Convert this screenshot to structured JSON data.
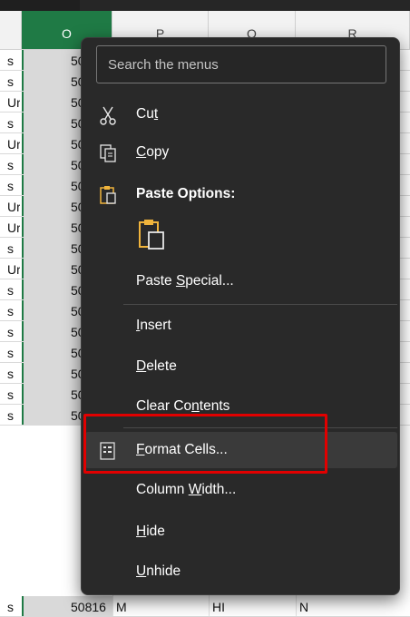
{
  "spreadsheet": {
    "columns": [
      "",
      "O",
      "P",
      "Q",
      "R"
    ],
    "rows": [
      {
        "a": "s",
        "o": "50"
      },
      {
        "a": "s",
        "o": "50"
      },
      {
        "a": "Ur",
        "o": "50"
      },
      {
        "a": "s",
        "o": "50"
      },
      {
        "a": "Ur",
        "o": "50"
      },
      {
        "a": "s",
        "o": "50"
      },
      {
        "a": "s",
        "o": "50"
      },
      {
        "a": "Ur",
        "o": "50"
      },
      {
        "a": "Ur",
        "o": "50"
      },
      {
        "a": "s",
        "o": "50"
      },
      {
        "a": "Ur",
        "o": "50"
      },
      {
        "a": "s",
        "o": "50"
      },
      {
        "a": "s",
        "o": "50"
      },
      {
        "a": "s",
        "o": "50"
      },
      {
        "a": "s",
        "o": "50"
      },
      {
        "a": "s",
        "o": "50"
      },
      {
        "a": "s",
        "o": "50"
      },
      {
        "a": "s",
        "o": "50"
      },
      {
        "a": "s",
        "o": "50816",
        "p": "M",
        "q": "HI",
        "r": "N"
      }
    ]
  },
  "menu": {
    "search_placeholder": "Search the menus",
    "items": [
      {
        "pre": "Cu",
        "u": "t",
        "post": ""
      },
      {
        "pre": "",
        "u": "C",
        "post": "opy"
      },
      {
        "pre": "Paste Options:",
        "u": "",
        "post": ""
      },
      {
        "pre": "Paste ",
        "u": "S",
        "post": "pecial..."
      },
      {
        "pre": "",
        "u": "I",
        "post": "nsert"
      },
      {
        "pre": "",
        "u": "D",
        "post": "elete"
      },
      {
        "pre": "Clear Co",
        "u": "n",
        "post": "tents"
      },
      {
        "pre": "",
        "u": "F",
        "post": "ormat Cells..."
      },
      {
        "pre": "Column ",
        "u": "W",
        "post": "idth..."
      },
      {
        "pre": "",
        "u": "H",
        "post": "ide"
      },
      {
        "pre": "",
        "u": "U",
        "post": "nhide"
      }
    ]
  },
  "colors": {
    "menu_bg": "#292929",
    "accent_green": "#1f7a45",
    "highlight_red": "#e10000",
    "paste_icon": "#f0b43c"
  }
}
